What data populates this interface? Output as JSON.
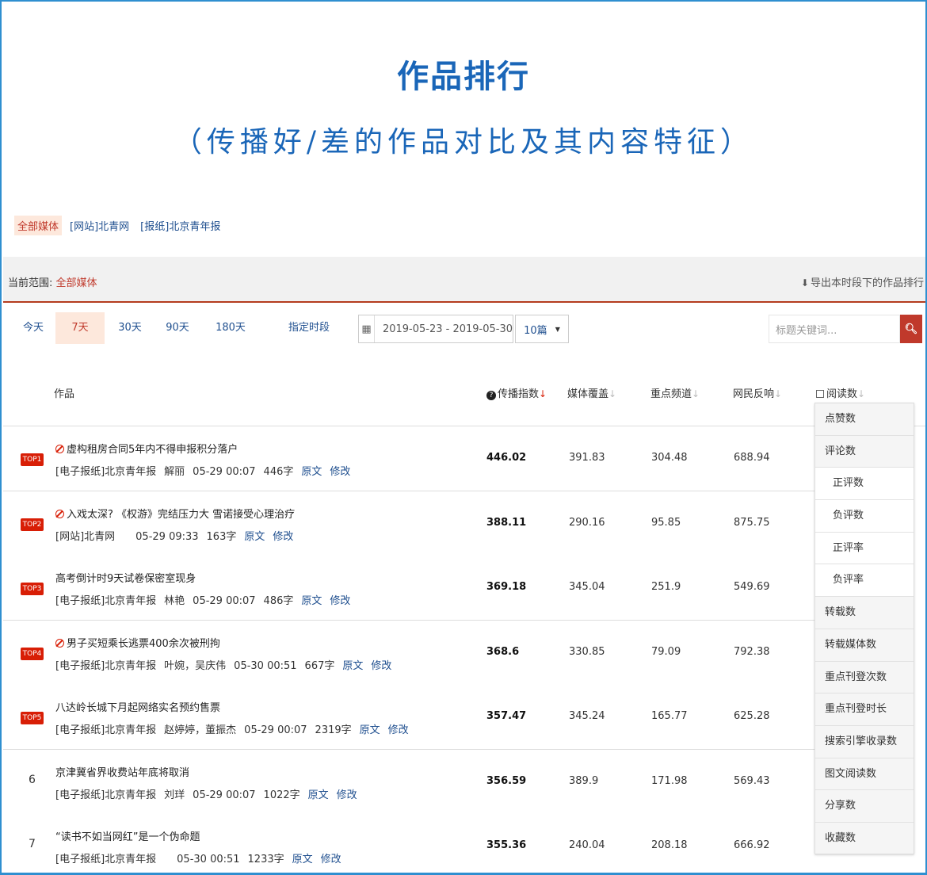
{
  "header": {
    "title": "作品排行",
    "subtitle": "（传播好/差的作品对比及其内容特征）"
  },
  "media_tabs": [
    {
      "label": "全部媒体",
      "active": true
    },
    {
      "label": "[网站]北青网",
      "active": false
    },
    {
      "label": "[报纸]北京青年报",
      "active": false
    }
  ],
  "scope": {
    "label": "当前范围:",
    "value": "全部媒体",
    "export_label": "导出本时段下的作品排行"
  },
  "filters": {
    "ranges": [
      {
        "label": "今天",
        "active": false
      },
      {
        "label": "7天",
        "active": true
      },
      {
        "label": "30天",
        "active": false
      },
      {
        "label": "90天",
        "active": false
      },
      {
        "label": "180天",
        "active": false
      },
      {
        "label": "指定时段",
        "active": false
      }
    ],
    "date_range": "2019-05-23 - 2019-05-30",
    "count_selected": "10篇",
    "search_placeholder": "标题关键词..."
  },
  "table": {
    "columns": {
      "work": "作品",
      "spread_index": "传播指数",
      "media_coverage": "媒体覆盖",
      "key_channel": "重点频道",
      "netizen_response": "网民反响",
      "read_count": "阅读数"
    },
    "rows": [
      {
        "rank": "TOP1",
        "badge": true,
        "warn": true,
        "title": "虚构租房合同5年内不得申报积分落户",
        "source": "[电子报纸]北京青年报",
        "author": "解丽",
        "time": "05-29 00:07",
        "words": "446字",
        "link_orig": "原文",
        "link_edit": "修改",
        "spread": "446.02",
        "coverage": "391.83",
        "channel": "304.48",
        "response": "688.94"
      },
      {
        "rank": "TOP2",
        "badge": true,
        "warn": true,
        "title": "入戏太深? 《权游》完结压力大 雪诺接受心理治疗",
        "source": "[网站]北青网",
        "author": "",
        "time": "05-29 09:33",
        "words": "163字",
        "link_orig": "原文",
        "link_edit": "修改",
        "spread": "388.11",
        "coverage": "290.16",
        "channel": "95.85",
        "response": "875.75"
      },
      {
        "rank": "TOP3",
        "badge": true,
        "warn": false,
        "title": "高考倒计时9天试卷保密室现身",
        "source": "[电子报纸]北京青年报",
        "author": "林艳",
        "time": "05-29 00:07",
        "words": "486字",
        "link_orig": "原文",
        "link_edit": "修改",
        "spread": "369.18",
        "coverage": "345.04",
        "channel": "251.9",
        "response": "549.69"
      },
      {
        "rank": "TOP4",
        "badge": true,
        "warn": true,
        "title": "男子买短乘长逃票400余次被刑拘",
        "source": "[电子报纸]北京青年报",
        "author": "叶婉，吴庆伟",
        "time": "05-30 00:51",
        "words": "667字",
        "link_orig": "原文",
        "link_edit": "修改",
        "spread": "368.6",
        "coverage": "330.85",
        "channel": "79.09",
        "response": "792.38"
      },
      {
        "rank": "TOP5",
        "badge": true,
        "warn": false,
        "title": "八达岭长城下月起网络实名预约售票",
        "source": "[电子报纸]北京青年报",
        "author": "赵婷婷，董振杰",
        "time": "05-29 00:07",
        "words": "2319字",
        "link_orig": "原文",
        "link_edit": "修改",
        "spread": "357.47",
        "coverage": "345.24",
        "channel": "165.77",
        "response": "625.28"
      },
      {
        "rank": "6",
        "badge": false,
        "warn": false,
        "title": "京津冀省界收费站年底将取消",
        "source": "[电子报纸]北京青年报",
        "author": "刘珜",
        "time": "05-29 00:07",
        "words": "1022字",
        "link_orig": "原文",
        "link_edit": "修改",
        "spread": "356.59",
        "coverage": "389.9",
        "channel": "171.98",
        "response": "569.43"
      },
      {
        "rank": "7",
        "badge": false,
        "warn": false,
        "title": "“读书不如当网红”是一个伪命题",
        "source": "[电子报纸]北京青年报",
        "author": "",
        "time": "05-30 00:51",
        "words": "1233字",
        "link_orig": "原文",
        "link_edit": "修改",
        "spread": "355.36",
        "coverage": "240.04",
        "channel": "208.18",
        "response": "666.92"
      }
    ]
  },
  "metric_dropdown": [
    {
      "label": "点赞数",
      "sub": false
    },
    {
      "label": "评论数",
      "sub": false
    },
    {
      "label": "正评数",
      "sub": true
    },
    {
      "label": "负评数",
      "sub": true
    },
    {
      "label": "正评率",
      "sub": true
    },
    {
      "label": "负评率",
      "sub": true
    },
    {
      "label": "转载数",
      "sub": false
    },
    {
      "label": "转载媒体数",
      "sub": false
    },
    {
      "label": "重点刊登次数",
      "sub": false
    },
    {
      "label": "重点刊登时长",
      "sub": false
    },
    {
      "label": "搜索引擎收录数",
      "sub": false
    },
    {
      "label": "图文阅读数",
      "sub": false
    },
    {
      "label": "分享数",
      "sub": false
    },
    {
      "label": "收藏数",
      "sub": false
    }
  ],
  "icons": {
    "calendar": "calendar-icon",
    "search": "search-icon",
    "download": "download-icon",
    "warning": "warning-icon",
    "help": "help-icon",
    "sort": "sort-arrow-icon"
  },
  "colors": {
    "title_blue": "#1a66b8",
    "accent_red": "#d81e06",
    "link_blue": "#1f4f8f",
    "active_bg": "#fde8dc"
  }
}
